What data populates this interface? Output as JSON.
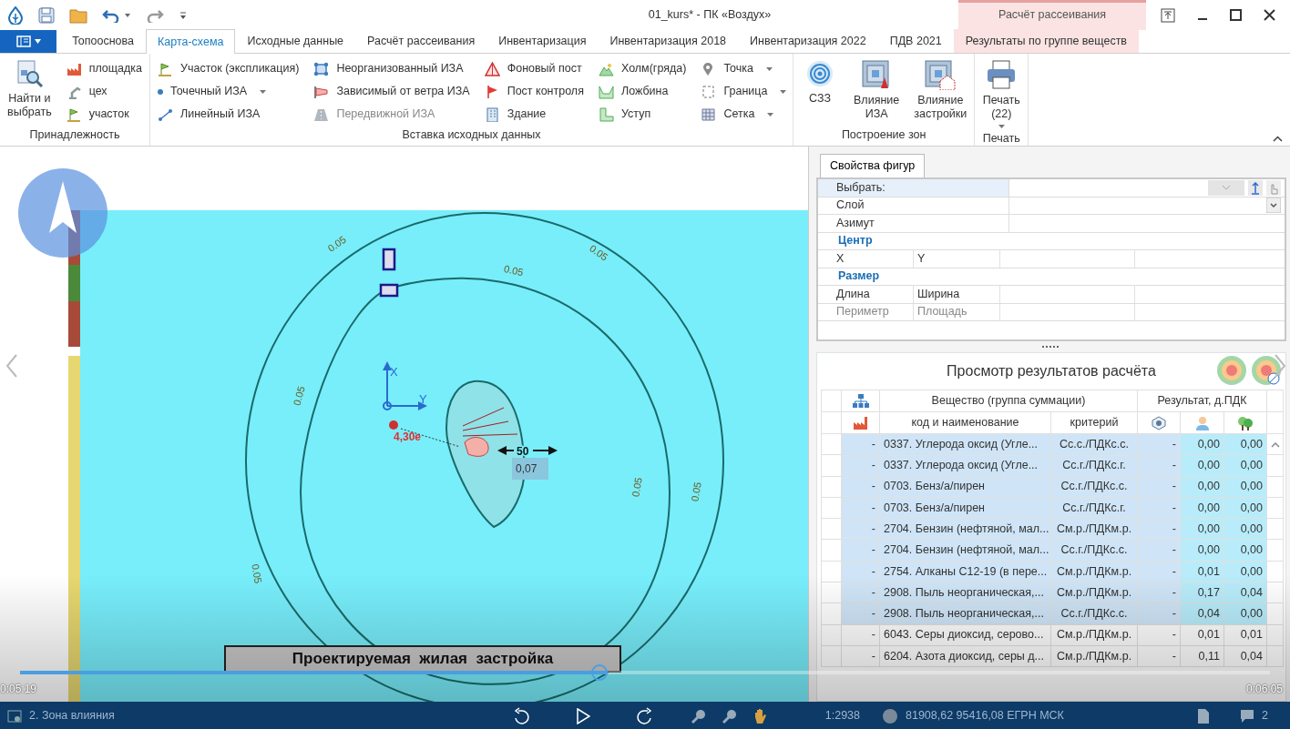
{
  "window": {
    "title": "01_kurs* - ПК «Воздух»",
    "context_group": "Расчёт рассеивания"
  },
  "tabs": [
    {
      "label": "Топооснова",
      "selected": false,
      "kind": "normal"
    },
    {
      "label": "Карта-схема",
      "selected": true,
      "kind": "normal"
    },
    {
      "label": "Исходные данные",
      "selected": false,
      "kind": "normal"
    },
    {
      "label": "Расчёт рассеивания",
      "selected": false,
      "kind": "normal"
    },
    {
      "label": "Инвентаризация",
      "selected": false,
      "kind": "normal"
    },
    {
      "label": "Инвентаризация 2018",
      "selected": false,
      "kind": "normal"
    },
    {
      "label": "Инвентаризация 2022",
      "selected": false,
      "kind": "normal"
    },
    {
      "label": "ПДВ 2021",
      "selected": false,
      "kind": "normal"
    },
    {
      "label": "Результаты по группе веществ",
      "selected": false,
      "kind": "contextual"
    }
  ],
  "ribbon_groups": [
    {
      "label": "Принадлежность",
      "columns": [
        [
          {
            "label": "Найти и выбрать",
            "kind": "large",
            "dropdown": false,
            "disabled": false
          }
        ],
        [
          {
            "label": "площадка",
            "kind": "small",
            "dropdown": false,
            "disabled": false
          },
          {
            "label": "цех",
            "kind": "small",
            "dropdown": false,
            "disabled": false
          },
          {
            "label": "участок",
            "kind": "small",
            "dropdown": false,
            "disabled": false
          }
        ]
      ]
    },
    {
      "label": "Вставка исходных данных",
      "columns": [
        [
          {
            "label": "Участок (экспликация)",
            "kind": "small",
            "dropdown": false,
            "disabled": false
          },
          {
            "label": "Точечный ИЗА",
            "kind": "small",
            "dropdown": true,
            "disabled": false
          },
          {
            "label": "Линейный ИЗА",
            "kind": "small",
            "dropdown": false,
            "disabled": false
          }
        ],
        [
          {
            "label": "Неорганизованный ИЗА",
            "kind": "small",
            "dropdown": false,
            "disabled": false
          },
          {
            "label": "Зависимый от ветра ИЗА",
            "kind": "small",
            "dropdown": false,
            "disabled": false
          },
          {
            "label": "Передвижной ИЗА",
            "kind": "small",
            "dropdown": false,
            "disabled": true
          }
        ],
        [
          {
            "label": "Фоновый пост",
            "kind": "small",
            "dropdown": false,
            "disabled": false
          },
          {
            "label": "Пост  контроля",
            "kind": "small",
            "dropdown": false,
            "disabled": false
          },
          {
            "label": "Здание",
            "kind": "small",
            "dropdown": false,
            "disabled": false
          }
        ],
        [
          {
            "label": "Холм(гряда)",
            "kind": "small",
            "dropdown": false,
            "disabled": false
          },
          {
            "label": "Ложбина",
            "kind": "small",
            "dropdown": false,
            "disabled": false
          },
          {
            "label": "Уступ",
            "kind": "small",
            "dropdown": false,
            "disabled": false
          }
        ],
        [
          {
            "label": "Точка",
            "kind": "small",
            "dropdown": true,
            "disabled": false
          },
          {
            "label": "Граница",
            "kind": "small",
            "dropdown": true,
            "disabled": false
          },
          {
            "label": "Сетка",
            "kind": "small",
            "dropdown": true,
            "disabled": false
          }
        ]
      ]
    },
    {
      "label": "Построение зон",
      "columns": [
        [
          {
            "label": "СЗЗ",
            "kind": "large",
            "dropdown": false,
            "disabled": false
          }
        ],
        [
          {
            "label": "Влияние ИЗА",
            "kind": "large",
            "dropdown": false,
            "disabled": false
          }
        ],
        [
          {
            "label": "Влияние застройки",
            "kind": "large",
            "dropdown": false,
            "disabled": false
          }
        ]
      ]
    },
    {
      "label": "Печать",
      "columns": [
        [
          {
            "label": "Печать (22)",
            "kind": "large",
            "dropdown": true,
            "disabled": false
          }
        ]
      ]
    }
  ],
  "map": {
    "axis_x": "X",
    "axis_y": "Y",
    "contour_labels": [
      "0.05",
      "0.05",
      "0.05",
      "0.05",
      "0.05",
      "0.05",
      "0.05"
    ],
    "point_label": "4,30e",
    "scale_label": "50",
    "value_label": "0,07",
    "caption": "Проектируемая  жилая  застройка"
  },
  "properties": {
    "tab": {
      "label": "Свойства фигур",
      "selected": true
    },
    "rows": [
      {
        "kind": "field",
        "label": "Выбрать:",
        "selected": true
      },
      {
        "kind": "field",
        "label": "Слой",
        "selected": false
      },
      {
        "kind": "field",
        "label": "Азимут",
        "selected": false
      },
      {
        "kind": "section",
        "label": "Центр"
      },
      {
        "kind": "pair",
        "labels": [
          "X",
          "Y"
        ],
        "disabled": false
      },
      {
        "kind": "section",
        "label": "Размер"
      },
      {
        "kind": "pair",
        "labels": [
          "Длина",
          "Ширина"
        ],
        "disabled": false
      },
      {
        "kind": "pair",
        "labels": [
          "Периметр",
          "Площадь"
        ],
        "disabled": true
      }
    ]
  },
  "results": {
    "title": "Просмотр результатов расчёта",
    "header_top": [
      "Вещество (группа суммации)",
      "Результат, д.ПДК"
    ],
    "header_bottom": [
      "код и наименование",
      "критерий"
    ],
    "rows": [
      {
        "marker": "-",
        "name": "0337. Углерода оксид (Угле...",
        "criterion": "Сс.с./ПДКс.с.",
        "c1": "-",
        "c2": "0,00",
        "c3": "0,00",
        "selected": true
      },
      {
        "marker": "-",
        "name": "0337. Углерода оксид (Угле...",
        "criterion": "Сс.г./ПДКс.г.",
        "c1": "-",
        "c2": "0,00",
        "c3": "0,00",
        "selected": true
      },
      {
        "marker": "-",
        "name": "0703. Бенз/а/пирен",
        "criterion": "Сс.г./ПДКс.с.",
        "c1": "-",
        "c2": "0,00",
        "c3": "0,00",
        "selected": true
      },
      {
        "marker": "-",
        "name": "0703. Бенз/а/пирен",
        "criterion": "Сс.г./ПДКс.г.",
        "c1": "-",
        "c2": "0,00",
        "c3": "0,00",
        "selected": true
      },
      {
        "marker": "-",
        "name": "2704. Бензин (нефтяной, мал...",
        "criterion": "См.р./ПДКм.р.",
        "c1": "-",
        "c2": "0,00",
        "c3": "0,00",
        "selected": true
      },
      {
        "marker": "-",
        "name": "2704. Бензин (нефтяной, мал...",
        "criterion": "Сс.г./ПДКс.с.",
        "c1": "-",
        "c2": "0,00",
        "c3": "0,00",
        "selected": true
      },
      {
        "marker": "-",
        "name": "2754. Алканы С12-19 (в пере...",
        "criterion": "См.р./ПДКм.р.",
        "c1": "-",
        "c2": "0,01",
        "c3": "0,00",
        "selected": true
      },
      {
        "marker": "-",
        "name": "2908. Пыль неорганическая,...",
        "criterion": "См.р./ПДКм.р.",
        "c1": "-",
        "c2": "0,17",
        "c3": "0,04",
        "selected": true
      },
      {
        "marker": "-",
        "name": "2908. Пыль неорганическая,...",
        "criterion": "Сс.г./ПДКс.с.",
        "c1": "-",
        "c2": "0,04",
        "c3": "0,00",
        "selected": true
      },
      {
        "marker": "-",
        "name": "6043. Серы диоксид, серово...",
        "criterion": "См.р./ПДКм.р.",
        "c1": "-",
        "c2": "0,01",
        "c3": "0,01",
        "selected": false
      },
      {
        "marker": "-",
        "name": "6204. Азота диоксид, серы д...",
        "criterion": "См.р./ПДКм.р.",
        "c1": "-",
        "c2": "0,11",
        "c3": "0,04",
        "selected": false
      }
    ]
  },
  "video": {
    "elapsed": "0:05:19",
    "total": "0:06:05",
    "progress": {
      "level": 0.47
    }
  },
  "status_bar": {
    "layer": "2. Зона влияния",
    "scale": "1:2938",
    "coordinates": "81908,62 95416,08 ЕГРН МСК",
    "count": "2"
  }
}
